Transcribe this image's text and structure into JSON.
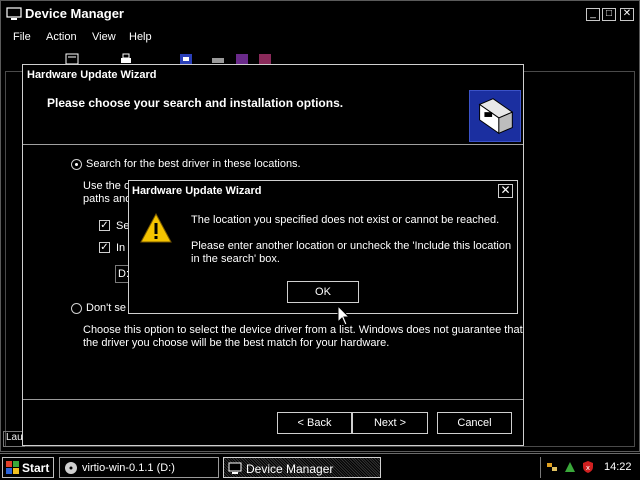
{
  "colors": {
    "background": "#000000",
    "text": "#ffffff",
    "border": "#cfcfcf",
    "header_icon": "#1b2fa0",
    "warning": "#f5c400"
  },
  "device_manager": {
    "title": "Device Manager",
    "menu": [
      "File",
      "Action",
      "View",
      "Help"
    ],
    "status_text": "Lau",
    "caption_buttons": {
      "minimize": "_",
      "maximize": "□",
      "close": "✕"
    }
  },
  "wizard": {
    "title": "Hardware Update Wizard",
    "header_text": "Please choose your search and installation options.",
    "radio_search_label": "Search for the best driver in these locations.",
    "use_text_line1": "Use the c",
    "use_text_line2": "paths and",
    "check1_label": "Se",
    "check2_label": "In",
    "path_value": "D:",
    "radio_dont_label": "Don't se",
    "choose_desc_line1": "Choose this option to select the device driver from a list.  Windows does not guarantee that",
    "choose_desc_line2": "the driver you choose will be the best match for your hardware.",
    "back_label": "< Back",
    "next_label": "Next >",
    "cancel_label": "Cancel"
  },
  "message_box": {
    "title": "Hardware Update Wizard",
    "close_label": "✕",
    "line1": "The location you specified does not exist or cannot be reached.",
    "line2": "Please enter another location or uncheck the 'Include this location in the search' box.",
    "ok_label": "OK"
  },
  "taskbar": {
    "start_label": "Start",
    "tasks": [
      "virtio-win-0.1.1 (D:)",
      "Device Manager"
    ],
    "clock": "14:22"
  }
}
